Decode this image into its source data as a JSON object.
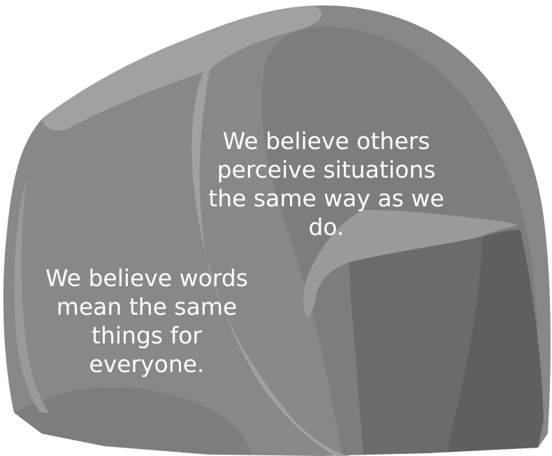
{
  "rock": {
    "colors": {
      "base": "#8a878b",
      "light": "#a3a0a4",
      "mid": "#7f7c80",
      "dark": "#6d6a6e",
      "darker": "#615e62",
      "highlight": "#9c999d"
    }
  },
  "captions": {
    "right": "We believe others\nperceive situations\nthe same way as we\ndo.",
    "left": "We believe words\nmean the same\nthings for\neveryone."
  }
}
